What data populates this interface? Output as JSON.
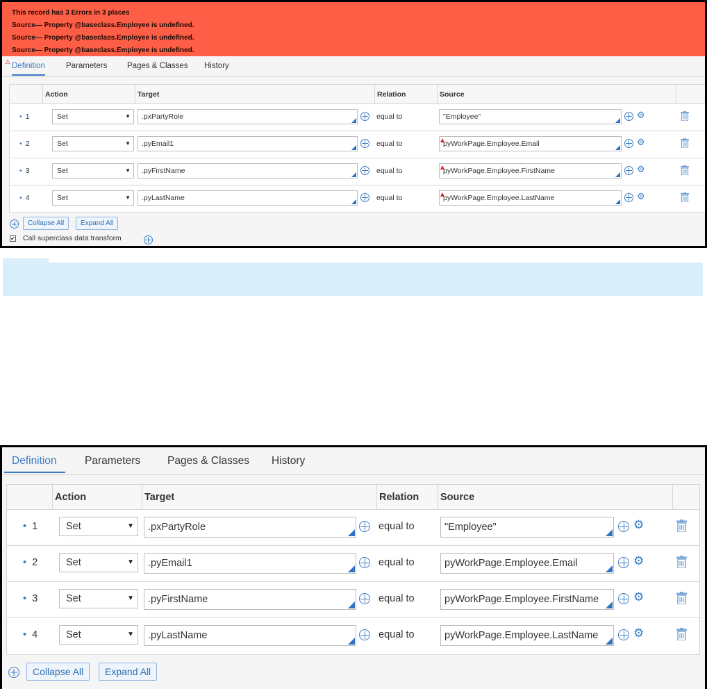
{
  "errors": {
    "summary": "This record has 3 Errors in 3 places",
    "messages": [
      "Source— Property @baseclass.Employee is undefined.",
      "Source— Property @baseclass.Employee is undefined.",
      "Source— Property @baseclass.Employee is undefined."
    ]
  },
  "tabs": [
    "Definition",
    "Parameters",
    "Pages & Classes",
    "History"
  ],
  "columns": {
    "action": "Action",
    "target": "Target",
    "relation": "Relation",
    "source": "Source"
  },
  "rows": [
    {
      "num": "1",
      "action": "Set",
      "target": ".pxPartyRole",
      "relation": "equal to",
      "source_top": "\"Employee\"",
      "source_bottom": "\"Employee\""
    },
    {
      "num": "2",
      "action": "Set",
      "target": ".pyEmail1",
      "relation": "equal to",
      "source_top": "pyWorkPage.Employee.Email",
      "source_bottom": "pyWorkPage.Employee.Email"
    },
    {
      "num": "3",
      "action": "Set",
      "target": ".pyFirstName",
      "relation": "equal to",
      "source_top": "pyWorkPage.Employee.FirstName",
      "source_bottom": "pyWorkPage.Employee.FirstName"
    },
    {
      "num": "4",
      "action": "Set",
      "target": ".pyLastName",
      "relation": "equal to",
      "source_top": "pyWorkPage.Employee.LastName",
      "source_bottom": "pyWorkPage.Employee.LastName"
    }
  ],
  "buttons": {
    "collapse_all": "Collapse All",
    "expand_all": "Expand All"
  },
  "call_superclass": {
    "label": "Call superclass data transform",
    "checked": true
  },
  "colors": {
    "error_banner": "#ff5e46",
    "accent": "#3a7cc4",
    "info_strip": "#d9eefb"
  },
  "icons": [
    "warning-icon",
    "add-circle-icon",
    "crosshair-icon",
    "gear-icon",
    "trash-icon",
    "dropdown-arrow-icon"
  ]
}
